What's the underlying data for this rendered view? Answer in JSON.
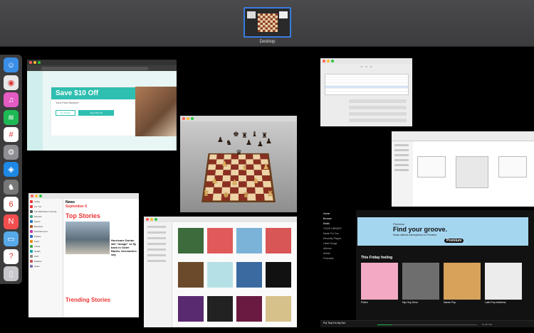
{
  "spaces": {
    "desktop_label": "Desktop"
  },
  "dock": [
    {
      "name": "finder-icon",
      "color": "#3a8ee6",
      "glyph": "☺"
    },
    {
      "name": "chrome-icon",
      "color": "#e8e8e8",
      "glyph": "◉"
    },
    {
      "name": "itunes-icon",
      "color": "#e45bc4",
      "glyph": "♫"
    },
    {
      "name": "spotify-icon",
      "color": "#1db954",
      "glyph": "≋"
    },
    {
      "name": "slack-icon",
      "color": "#ffffff",
      "glyph": "#"
    },
    {
      "name": "system-preferences-icon",
      "color": "#8e8e93",
      "glyph": "⚙"
    },
    {
      "name": "safari-icon",
      "color": "#1e88e5",
      "glyph": "◈"
    },
    {
      "name": "chess-icon",
      "color": "#777777",
      "glyph": "♞"
    },
    {
      "name": "calendar-icon",
      "color": "#ffffff",
      "glyph": "6"
    },
    {
      "name": "news-icon",
      "color": "#f24e4e",
      "glyph": "N"
    },
    {
      "name": "downloads-folder-icon",
      "color": "#57a9e8",
      "glyph": "▭"
    },
    {
      "name": "help-icon",
      "color": "#ffffff",
      "glyph": "?"
    },
    {
      "name": "trash-icon",
      "color": "#c7c7cc",
      "glyph": "▯"
    }
  ],
  "browser": {
    "promo_title": "Save $10 Off",
    "promo_subtitle": "Your First Service*",
    "button_left": "No Thanks",
    "button_right": "Save $10 Off"
  },
  "news": {
    "logo": "News",
    "date": "September 6",
    "section_top": "Top Stories",
    "headline": "Hurricane Dorian will \"ravage\" or fly back in Outer Banks, forecasters say",
    "section_trending": "Trending Stories",
    "sidebar": [
      "Today",
      "For You",
      "The Wall Street Journal",
      "Science",
      "Sports",
      "Business",
      "Entertainment",
      "Politics",
      "Food",
      "Travel",
      "Health",
      "Tech",
      "Fashion",
      "Autos"
    ]
  },
  "spotify": {
    "sidebar": [
      "Home",
      "Browse",
      "Radio",
      "YOUR LIBRARY",
      "Made For You",
      "Recently Played",
      "Liked Songs",
      "Albums",
      "Artists",
      "Podcasts"
    ],
    "banner_small": "Premium",
    "banner_title": "Find your groove.",
    "banner_sub": "Music without interruptions on Premium.",
    "banner_button": "Premium",
    "section_title": "This Friday feeling",
    "cards": [
      {
        "title": "Pollen",
        "color": "#f3a9c4"
      },
      {
        "title": "Hip-Hop Drive",
        "color": "#6e6e6e"
      },
      {
        "title": "Dance Pop",
        "color": "#d8a25a"
      },
      {
        "title": "Latin Pop Anthems",
        "color": "#ececec"
      }
    ],
    "now_playing": "Put That On My Set",
    "now_artist": "Lil Uzi Vert"
  }
}
